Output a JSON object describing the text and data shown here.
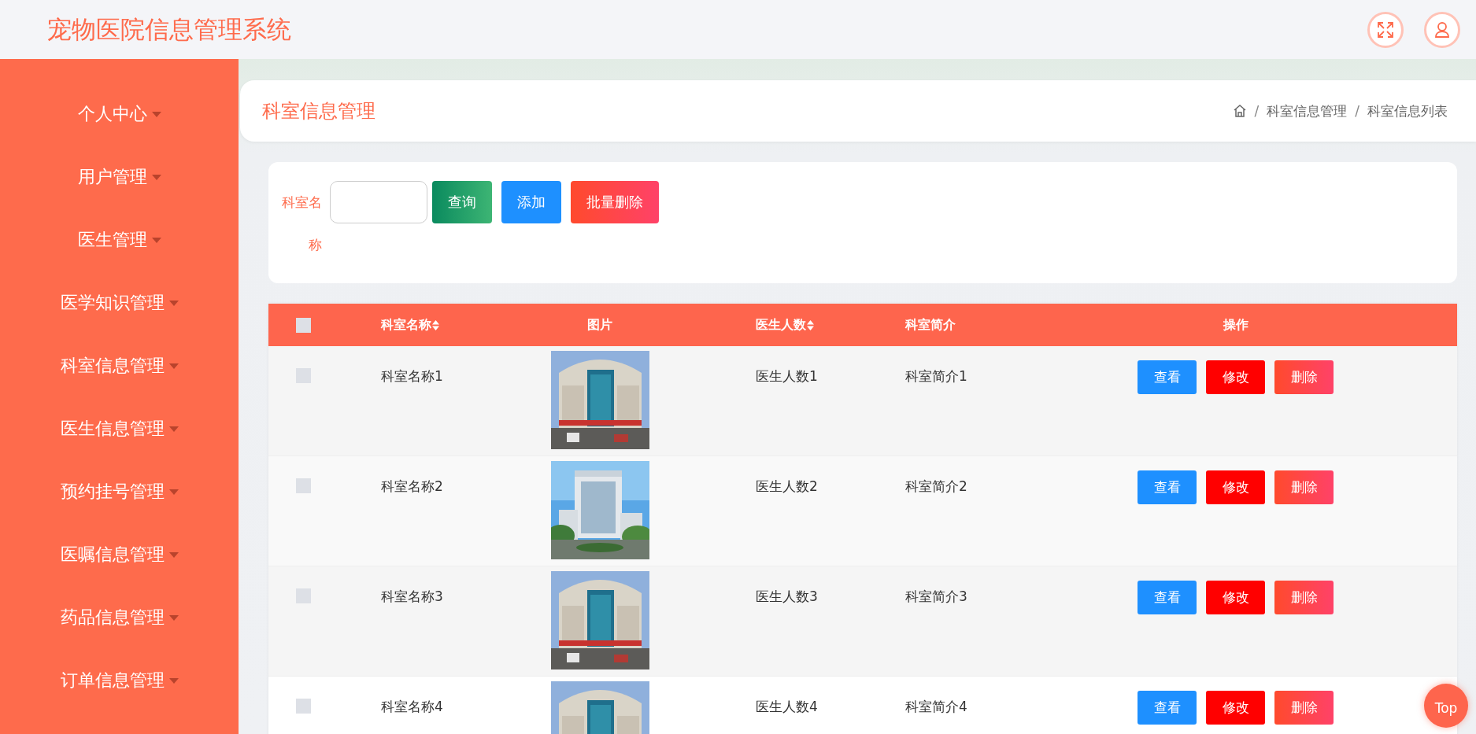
{
  "header": {
    "title": "宠物医院信息管理系统"
  },
  "sidebar": {
    "items": [
      {
        "label": "个人中心"
      },
      {
        "label": "用户管理"
      },
      {
        "label": "医生管理"
      },
      {
        "label": "医学知识管理"
      },
      {
        "label": "科室信息管理"
      },
      {
        "label": "医生信息管理"
      },
      {
        "label": "预约挂号管理"
      },
      {
        "label": "医嘱信息管理"
      },
      {
        "label": "药品信息管理"
      },
      {
        "label": "订单信息管理"
      }
    ]
  },
  "page": {
    "title": "科室信息管理",
    "breadcrumb": [
      {
        "kind": "separator",
        "label": "/"
      },
      {
        "kind": "link",
        "label": "科室信息管理"
      },
      {
        "kind": "separator",
        "label": "/"
      },
      {
        "kind": "current",
        "label": "科室信息列表"
      }
    ]
  },
  "search": {
    "label": "科室名称",
    "buttons": [
      {
        "label": "查询",
        "kind": "search"
      },
      {
        "label": "添加",
        "kind": "add"
      },
      {
        "label": "批量删除",
        "kind": "batch-delete"
      }
    ]
  },
  "table": {
    "select_all": {
      "checked": false
    },
    "columns": [
      {
        "label": "科室名称",
        "sortable": true
      },
      {
        "label": "图片",
        "sortable": false
      },
      {
        "label": "医生人数",
        "sortable": true
      },
      {
        "label": "科室简介",
        "sortable": false
      },
      {
        "label": "操作",
        "sortable": false
      }
    ],
    "rows": [
      {
        "checked": false,
        "name": "科室名称1",
        "image": {
          "kind": "picture"
        },
        "doctors": "医生人数1",
        "intro": "科室简介1",
        "actions": [
          {
            "label": "查看",
            "kind": "view"
          },
          {
            "label": "修改",
            "kind": "edit"
          },
          {
            "label": "删除",
            "kind": "delete"
          }
        ]
      },
      {
        "checked": false,
        "name": "科室名称2",
        "image": {
          "kind": "picture"
        },
        "doctors": "医生人数2",
        "intro": "科室简介2",
        "actions": [
          {
            "label": "查看",
            "kind": "view"
          },
          {
            "label": "修改",
            "kind": "edit"
          },
          {
            "label": "删除",
            "kind": "delete"
          }
        ]
      },
      {
        "checked": false,
        "name": "科室名称3",
        "image": {
          "kind": "picture"
        },
        "doctors": "医生人数3",
        "intro": "科室简介3",
        "actions": [
          {
            "label": "查看",
            "kind": "view"
          },
          {
            "label": "修改",
            "kind": "edit"
          },
          {
            "label": "删除",
            "kind": "delete"
          }
        ]
      },
      {
        "checked": false,
        "name": "科室名称4",
        "image": {
          "kind": "picture"
        },
        "doctors": "医生人数4",
        "intro": "科室简介4",
        "actions": [
          {
            "label": "查看",
            "kind": "view"
          },
          {
            "label": "修改",
            "kind": "edit"
          },
          {
            "label": "删除",
            "kind": "delete"
          }
        ]
      }
    ]
  },
  "top_button": {
    "label": "Top"
  }
}
